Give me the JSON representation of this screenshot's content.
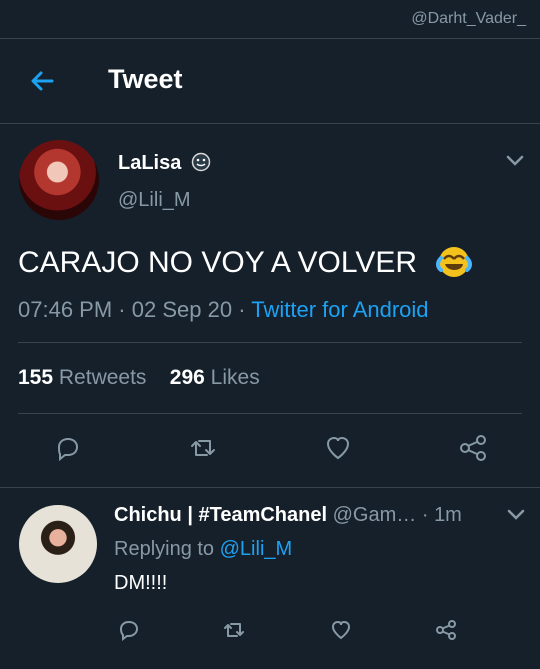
{
  "watermark": "@Darht_Vader_",
  "header": {
    "title": "Tweet"
  },
  "tweet": {
    "author_name": "LaLisa",
    "author_handle": "@Lili_M",
    "text": "CARAJO NO VOY A VOLVER",
    "time": "07:46 PM",
    "date": "02 Sep 20",
    "separator": "·",
    "source": "Twitter for Android",
    "retweets": "155",
    "retweets_label": "Retweets",
    "likes": "296",
    "likes_label": "Likes"
  },
  "reply": {
    "author_name": "Chichu | #TeamChanel",
    "author_handle": "@Gam…",
    "time": "1m",
    "replying_prefix": "Replying to",
    "replying_to": "@Lili_M",
    "text": "DM!!!!"
  },
  "colors": {
    "background": "#15202b",
    "accent": "#1da1f2",
    "secondary_text": "#8899a6",
    "divider": "#38444d"
  },
  "icons": [
    "back-arrow-icon",
    "face-emoji-icon",
    "chevron-down-icon",
    "laughing-crying-emoji-icon",
    "reply-icon",
    "retweet-icon",
    "like-icon",
    "share-icon"
  ]
}
